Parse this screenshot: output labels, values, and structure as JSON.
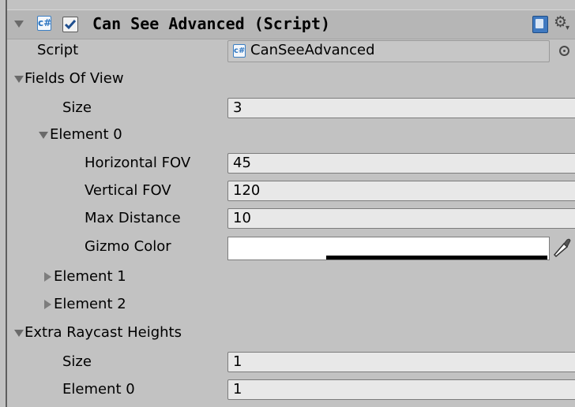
{
  "component": {
    "title": "Can See Advanced (Script)",
    "enabled": true
  },
  "script_field": {
    "label": "Script",
    "value": "CanSeeAdvanced"
  },
  "fields_of_view": {
    "label": "Fields Of View",
    "size_label": "Size",
    "size_value": "3",
    "element0": {
      "label": "Element 0",
      "horizontal_fov_label": "Horizontal FOV",
      "horizontal_fov_value": "45",
      "vertical_fov_label": "Vertical FOV",
      "vertical_fov_value": "120",
      "max_distance_label": "Max Distance",
      "max_distance_value": "10",
      "gizmo_color_label": "Gizmo Color",
      "gizmo_color": "#ffffff",
      "gizmo_alpha": 1.0
    },
    "element1_label": "Element 1",
    "element2_label": "Element 2"
  },
  "extra_raycast_heights": {
    "label": "Extra Raycast Heights",
    "size_label": "Size",
    "size_value": "1",
    "element0_label": "Element 0",
    "element0_value": "1"
  },
  "icons": {
    "foldout": "triangle-down-icon",
    "script": "cs-script-icon",
    "help": "book-icon",
    "settings": "gear-icon",
    "object_picker": "target-icon",
    "color_picker": "eyedropper-icon"
  }
}
